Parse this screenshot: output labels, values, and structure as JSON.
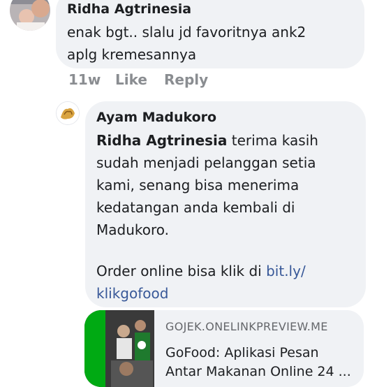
{
  "comment": {
    "author": "Ridha Agtrinesia",
    "text": "enak bgt.. slalu jd favoritnya ank2\naplg kremesannya",
    "time": "11w",
    "like_label": "Like",
    "reply_label": "Reply"
  },
  "reply": {
    "author": "Ayam Madukoro",
    "mention": "Ridha Agtrinesia",
    "text_line1": " terima kasih",
    "text_rest": "sudah menjadi pelanggan setia\nkami, senang bisa menerima\nkedatangan anda kembali di\nMadukoro.",
    "order_text": "Order online bisa klik di ",
    "link_line1": "bit.ly/",
    "link_line2": "klikgofood"
  },
  "preview": {
    "domain": "GOJEK.ONELINKPREVIEW.ME",
    "title": "GoFood: Aplikasi Pesan\nAntar Makanan Online 24 ..."
  },
  "colors": {
    "bubble": "#f0f2f5",
    "link": "#385898",
    "meta": "#8a8d91",
    "gojek_green": "#00aa13"
  }
}
